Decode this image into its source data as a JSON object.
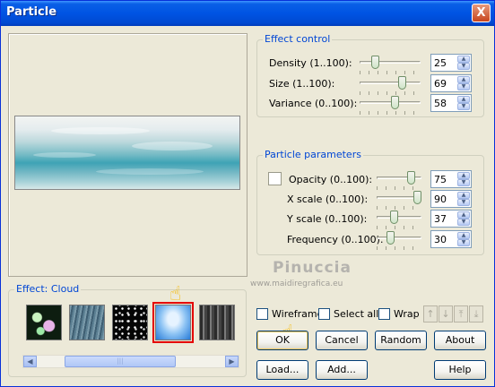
{
  "window": {
    "title": "Particle",
    "close_glyph": "X"
  },
  "effect_control": {
    "legend": "Effect control",
    "rows": [
      {
        "label": "Density (1..100):",
        "value": "25"
      },
      {
        "label": "Size (1..100):",
        "value": "69"
      },
      {
        "label": "Variance (0..100):",
        "value": "58"
      }
    ]
  },
  "particle_parameters": {
    "legend": "Particle parameters",
    "rows": [
      {
        "label": "Opacity (0..100):",
        "value": "75"
      },
      {
        "label": "X scale (0..100):",
        "value": "90"
      },
      {
        "label": "Y scale (0..100):",
        "value": "37"
      },
      {
        "label": "Frequency (0..100):",
        "value": "30"
      }
    ]
  },
  "effect": {
    "legend": "Effect: Cloud",
    "thumbnails": [
      "bokeh",
      "rain",
      "stars",
      "cloud",
      "smoke"
    ],
    "selected": "cloud"
  },
  "options": {
    "wireframe": "Wireframe",
    "select_all": "Select all",
    "wrap": "Wrap"
  },
  "buttons": {
    "ok": "OK",
    "cancel": "Cancel",
    "random": "Random",
    "about": "About",
    "load": "Load...",
    "add": "Add...",
    "help": "Help"
  },
  "watermark": {
    "name": "Pinuccia",
    "url": "www.maidiregrafica.eu"
  },
  "icons": {
    "close": "close-icon",
    "hand": "pointing-hand-icon",
    "arrows": [
      "arrow-up-icon",
      "arrow-down-icon",
      "arrow-top-icon",
      "arrow-bottom-icon"
    ]
  },
  "colors": {
    "title_bar": "#0054e3",
    "legend_text": "#0046d5",
    "selection": "#e40000",
    "dialog_bg": "#ece9d8"
  }
}
